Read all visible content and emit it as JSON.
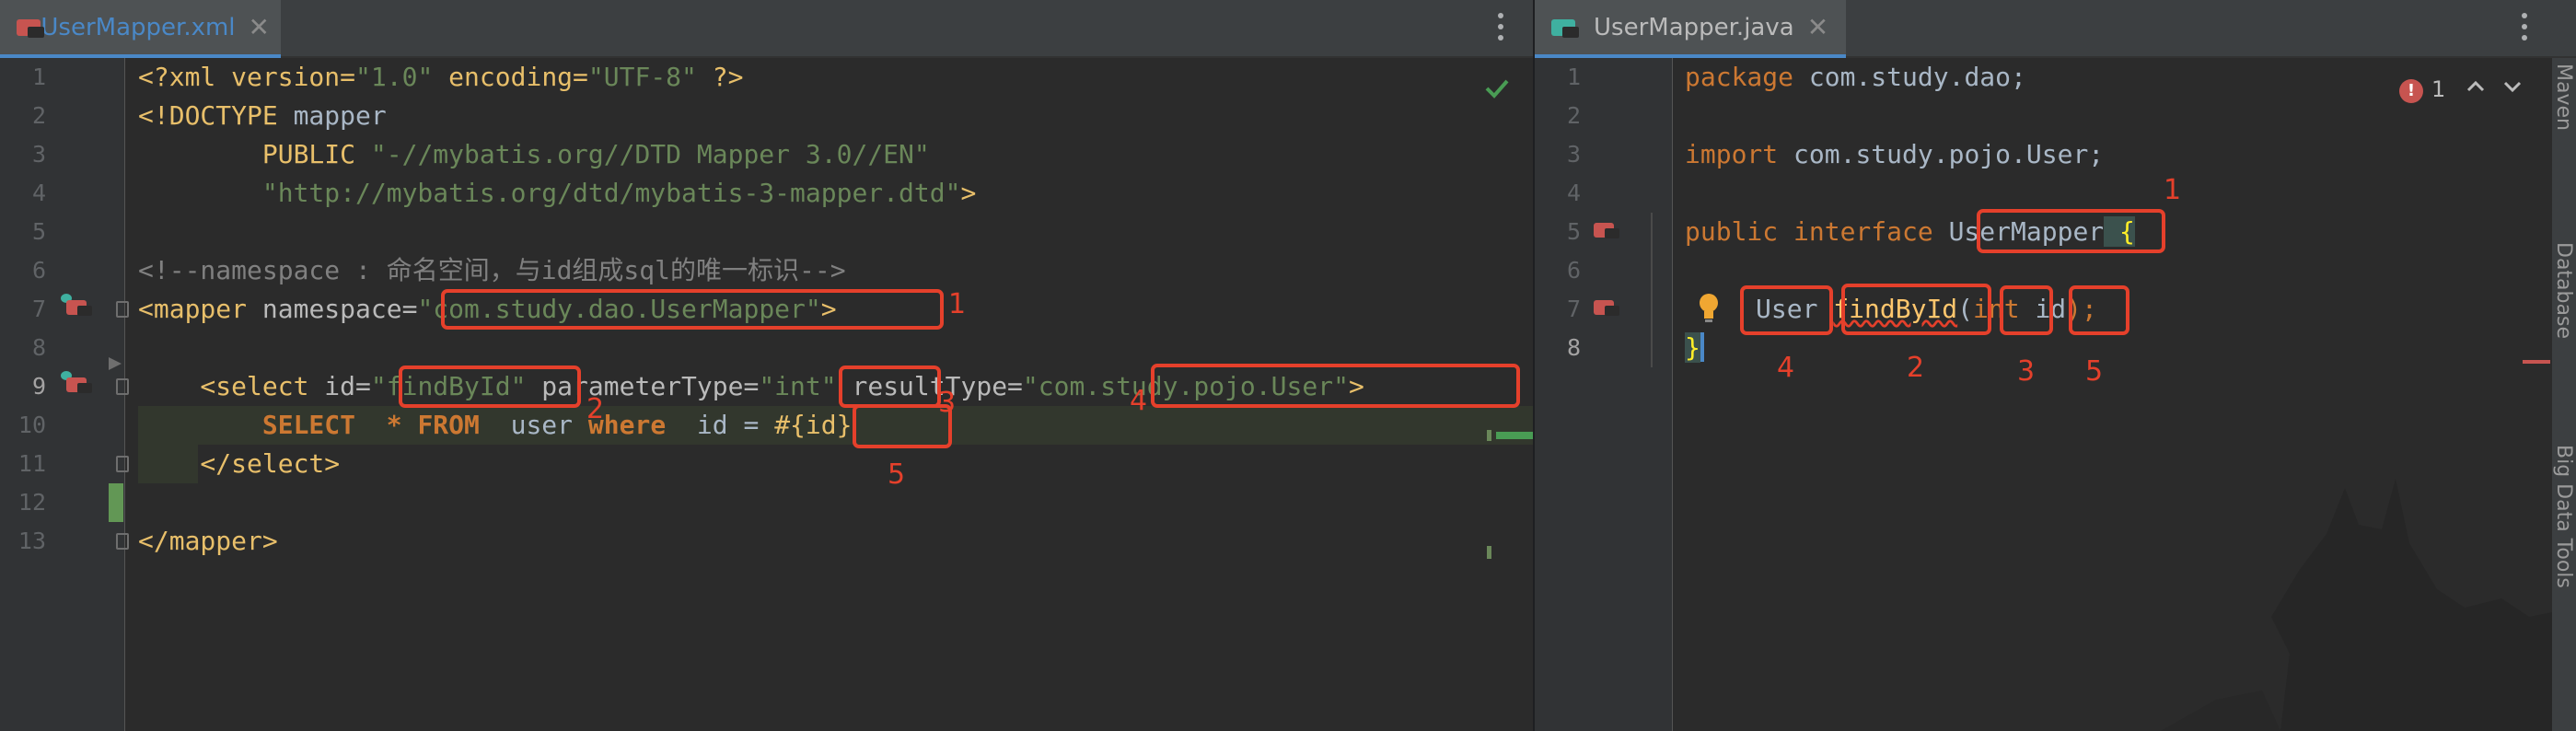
{
  "left_editor": {
    "tab_title": "UserMapper.xml",
    "line_numbers": [
      "1",
      "2",
      "3",
      "4",
      "5",
      "6",
      "7",
      "8",
      "9",
      "10",
      "11",
      "12",
      "13"
    ],
    "lines": {
      "l1_a": "<?xml version=",
      "l1_b": "\"1.0\"",
      "l1_c": " encoding=",
      "l1_d": "\"UTF-8\"",
      "l1_e": " ?>",
      "l2_a": "<!DOCTYPE",
      "l2_b": " mapper",
      "l3_a": "        PUBLIC ",
      "l3_b": "\"-//mybatis.org//DTD Mapper 3.0//EN\"",
      "l4_a": "        ",
      "l4_b": "\"http://mybatis.org/dtd/mybatis-3-mapper.dtd\"",
      "l4_c": ">",
      "l6": "<!--namespace : 命名空间，与id组成sql的唯一标识-->",
      "l7_a": "<mapper",
      "l7_b": " namespace=",
      "l7_c": "\"com.study.dao.UserMapper\"",
      "l7_d": ">",
      "l9_a": "    <select",
      "l9_b": " id=",
      "l9_c": "\"findById\"",
      "l9_d": " parameterType=",
      "l9_e": "\"int\"",
      "l9_f": " resultType=",
      "l9_g": "\"com.study.pojo.User\"",
      "l9_h": ">",
      "l10_a": "        SELECT",
      "l10_b": "  * FROM",
      "l10_c": "  user ",
      "l10_d": "where",
      "l10_e": "  id = ",
      "l10_f": "#{id}",
      "l11": "    </select>",
      "l13": "</mapper>"
    },
    "annotations": [
      "1",
      "2",
      "3",
      "4",
      "5"
    ]
  },
  "right_editor": {
    "tab_title": "UserMapper.java",
    "line_numbers": [
      "1",
      "2",
      "3",
      "4",
      "5",
      "6",
      "7",
      "8"
    ],
    "lines": {
      "l1_a": "package",
      "l1_b": " com.study.dao;",
      "l3_a": "import",
      "l3_b": " com.study.pojo.User;",
      "l5_a": "public interface ",
      "l5_b": "UserMapper",
      "l5_c": " {",
      "l7_a": "User ",
      "l7_b": "findById",
      "l7_c": "(",
      "l7_d": "int",
      "l7_e": " id",
      "l7_f": ");",
      "l8": "}"
    },
    "problems_count": "1",
    "annotations": [
      "1",
      "2",
      "3",
      "4",
      "5"
    ],
    "side_tools": [
      "Maven",
      "Database",
      "Big Data Tools"
    ]
  },
  "colors": {
    "background": "#2b2b2b",
    "gutter": "#313335",
    "tag": "#e8bf6a",
    "string": "#6a8759",
    "keyword": "#cc7832",
    "comment": "#808080",
    "function": "#ffc66d",
    "annotation_red": "#e5402b",
    "accent_blue": "#4a88c7"
  },
  "icons": [
    "file-type-icon",
    "close-icon",
    "more-options-icon",
    "check-icon",
    "error-icon",
    "arrow-up-icon",
    "arrow-down-icon",
    "intention-bulb-icon",
    "navigate-icon",
    "fold-icon"
  ]
}
